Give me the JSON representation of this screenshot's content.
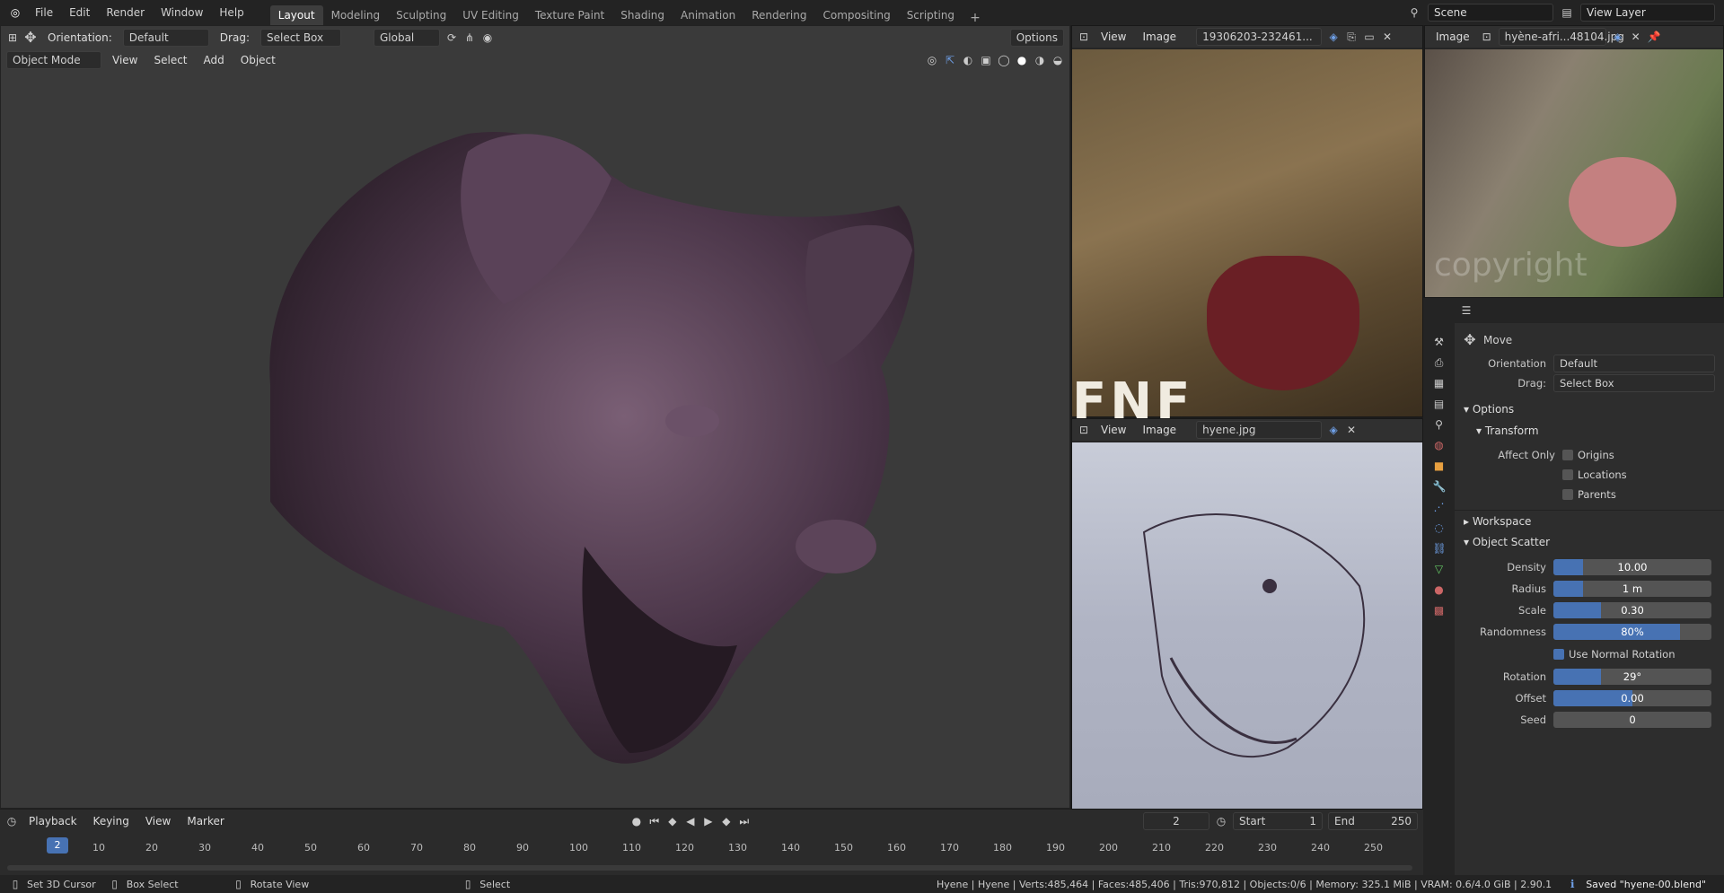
{
  "topbar": {
    "menus": [
      "File",
      "Edit",
      "Render",
      "Window",
      "Help"
    ],
    "tabs": [
      "Layout",
      "Modeling",
      "Sculpting",
      "UV Editing",
      "Texture Paint",
      "Shading",
      "Animation",
      "Rendering",
      "Compositing",
      "Scripting"
    ],
    "active_tab": "Layout",
    "add_tab": "+",
    "scene_value": "Scene",
    "view_layer_value": "View Layer"
  },
  "tool_header": {
    "orientation_label": "Orientation:",
    "orientation_value": "Default",
    "drag_label": "Drag:",
    "drag_value": "Select Box",
    "transform_value": "Global",
    "options_label": "Options"
  },
  "viewport_header": {
    "mode": "Object Mode",
    "menus": [
      "View",
      "Select",
      "Add",
      "Object"
    ]
  },
  "image_editor_top": {
    "menus": [
      "View",
      "Image"
    ],
    "image_name": "19306203-232461..."
  },
  "image_editor_right": {
    "menu": "Image",
    "image_name": "hyène-afri...48104.jpg",
    "watermark": "copyright"
  },
  "image_editor_bottom": {
    "menus": [
      "View",
      "Image"
    ],
    "image_name": "hyene.jpg"
  },
  "photo_text": "FNF",
  "properties": {
    "tool_name": "Move",
    "orientation_label": "Orientation",
    "orientation_value": "Default",
    "drag_label": "Drag:",
    "drag_value": "Select Box",
    "options_section": "Options",
    "transform_section": "Transform",
    "affect_only_label": "Affect Only",
    "affect_only": [
      "Origins",
      "Locations",
      "Parents"
    ],
    "workspace_section": "Workspace",
    "scatter_section": "Object Scatter",
    "sliders": [
      {
        "label": "Density",
        "value": "10.00",
        "fraction": 0.19
      },
      {
        "label": "Radius",
        "value": "1 m",
        "fraction": 0.19
      },
      {
        "label": "Scale",
        "value": "0.30",
        "fraction": 0.3
      },
      {
        "label": "Randomness",
        "value": "80%",
        "fraction": 0.8
      }
    ],
    "use_normal_rotation": "Use Normal Rotation",
    "sliders2": [
      {
        "label": "Rotation",
        "value": "29°",
        "fraction": 0.3
      },
      {
        "label": "Offset",
        "value": "0.00",
        "fraction": 0.5
      },
      {
        "label": "Seed",
        "value": "0",
        "fraction": 0.0
      }
    ]
  },
  "timeline": {
    "menus": [
      "Playback",
      "Keying",
      "View",
      "Marker"
    ],
    "current_frame": "2",
    "start_label": "Start",
    "start_value": "1",
    "end_label": "End",
    "end_value": "250",
    "ticks": [
      "10",
      "20",
      "30",
      "40",
      "50",
      "60",
      "70",
      "80",
      "90",
      "100",
      "110",
      "120",
      "130",
      "140",
      "150",
      "160",
      "170",
      "180",
      "190",
      "200",
      "210",
      "220",
      "230",
      "240",
      "250"
    ],
    "playhead": "2"
  },
  "statusbar": {
    "left": [
      "Set 3D Cursor",
      "Box Select",
      "Rotate View",
      "Select"
    ],
    "stats": "Hyene | Hyene | Verts:485,464 | Faces:485,406 | Tris:970,812 | Objects:0/6 | Memory: 325.1 MiB | VRAM: 0.6/4.0 GiB | 2.90.1",
    "saved": "Saved \"hyene-00.blend\""
  },
  "colors": {
    "accent": "#4772b3",
    "bg": "#1d1d1d"
  }
}
